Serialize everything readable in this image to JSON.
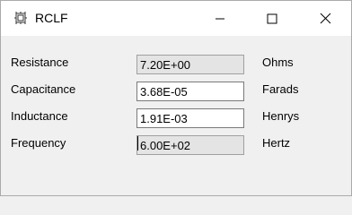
{
  "window": {
    "title": "RCLF"
  },
  "controls": {
    "minimize_icon": "minimize-icon",
    "maximize_icon": "maximize-icon",
    "close_icon": "close-icon"
  },
  "rows": [
    {
      "label": "Resistance",
      "value": "7.20E+00",
      "unit": "Ohms",
      "readonly": true
    },
    {
      "label": "Capacitance",
      "value": "3.68E-05",
      "unit": "Farads",
      "readonly": false
    },
    {
      "label": "Inductance",
      "value": "1.91E-03",
      "unit": "Henrys",
      "readonly": false
    },
    {
      "label": "Frequency",
      "value": "6.00E+02",
      "unit": "Hertz",
      "readonly": true
    }
  ]
}
